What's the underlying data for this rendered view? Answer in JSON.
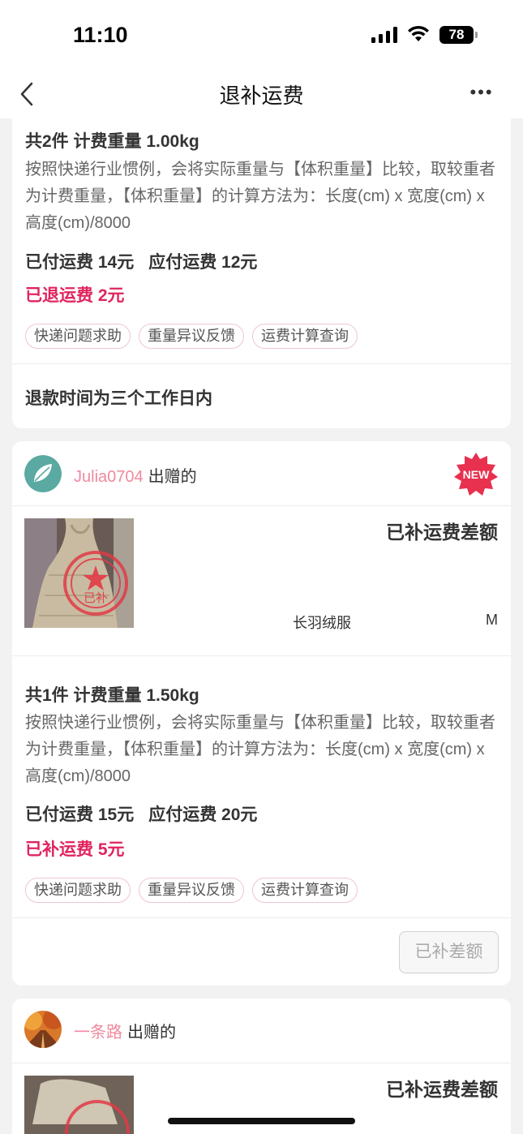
{
  "status_bar": {
    "time": "11:10",
    "battery": "78",
    "icons": [
      "signal-icon",
      "wifi-icon",
      "battery-icon"
    ]
  },
  "nav": {
    "title": "退补运费",
    "back_icon": "chevron-left-icon",
    "more_icon": "more-dots-icon",
    "more_label": "•••"
  },
  "colors": {
    "accent_pink": "#e0245e",
    "username_pink": "#f08a9e",
    "new_badge": "#e8304f"
  },
  "card1": {
    "weight": "共2件 计费重量 1.00kg",
    "desc": "按照快递行业惯例，会将实际重量与【体积重量】比较，取较重者为计费重量，【体积重量】的计算方法为：长度(cm) x 宽度(cm) x 高度(cm)/8000",
    "paid": "已付运费 14元",
    "due": "应付运费 12元",
    "refund": "已退运费 2元",
    "chips": [
      "快递问题求助",
      "重量异议反馈",
      "运费计算查询"
    ],
    "refund_time": "退款时间为三个工作日内"
  },
  "card2": {
    "username": "Julia0704",
    "donated": "出赠的",
    "badge": "NEW",
    "status": "已补运费差额",
    "item_name": "长羽绒服",
    "item_size": "M",
    "stamp_text": "已补",
    "weight": "共1件 计费重量 1.50kg",
    "desc": "按照快递行业惯例，会将实际重量与【体积重量】比较，取较重者为计费重量，【体积重量】的计算方法为：长度(cm) x 宽度(cm) x 高度(cm)/8000",
    "paid": "已付运费 15元",
    "due": "应付运费 20元",
    "refund": "已补运费 5元",
    "chips": [
      "快递问题求助",
      "重量异议反馈",
      "运费计算查询"
    ],
    "button": "已补差额"
  },
  "card3": {
    "username": "一条路",
    "donated": "出赠的",
    "status": "已补运费差额"
  }
}
